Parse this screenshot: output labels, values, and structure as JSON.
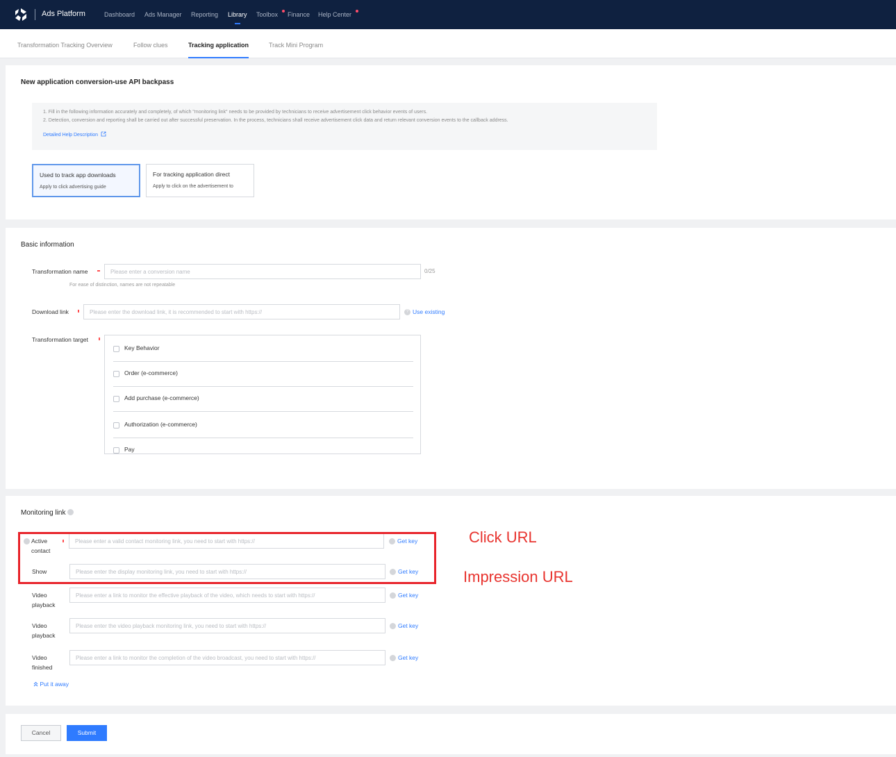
{
  "nav": {
    "brand": "Ads Platform",
    "items": [
      "Dashboard",
      "Ads Manager",
      "Reporting",
      "Library",
      "Toolbox",
      "Finance",
      "Help Center"
    ],
    "active": "Library"
  },
  "subtabs": [
    "Transformation Tracking Overview",
    "Follow clues",
    "Tracking application",
    "Track Mini Program"
  ],
  "intro": {
    "title": "New application conversion-use API backpass",
    "notice": [
      "1. Fill in the following information accurately and completely, of which \"monitoring link\" needs to be provided by technicians to receive advertisement click behavior events of users.",
      "2. Detection, conversion and reporting shall be carried out after successful preservation. In the process, technicians shall receive advertisement click data and return relevant conversion events to the callback address."
    ],
    "help_link": "Detailed Help Description",
    "options": [
      {
        "title": "Used to track app downloads",
        "subtitle": "Apply to click advertising guide",
        "selected": true
      },
      {
        "title": "For tracking application direct",
        "subtitle": "Apply to click on the advertisement to",
        "selected": false
      }
    ]
  },
  "basic": {
    "title": "Basic information",
    "name_label": "Transformation name",
    "name_placeholder": "Please enter a conversion name",
    "name_counter": "0/25",
    "name_hint": "For ease of distinction, names are not repeatable",
    "download_label": "Download link",
    "download_placeholder": "Please enter the download link, it is recommended to start with https://",
    "use_existing": "Use existing",
    "target_label": "Transformation target",
    "targets": [
      "Key Behavior",
      "Order (e-commerce)",
      "Add purchase (e-commerce)",
      "Authorization (e-commerce)",
      "Pay"
    ]
  },
  "monitoring": {
    "title": "Monitoring link",
    "get_key": "Get key",
    "rows": [
      {
        "label": "Active contact",
        "placeholder": "Please enter a valid contact monitoring link, you need to start with https://",
        "required": true
      },
      {
        "label": "Show",
        "placeholder": "Please enter the display monitoring link, you need to start with https://",
        "required": false
      },
      {
        "label": "Video playback",
        "placeholder": "Please enter a link to monitor the effective playback of the video, which needs to start with https://",
        "required": false
      },
      {
        "label": "Video playback",
        "placeholder": "Please enter the video playback monitoring link, you need to start with https://",
        "required": false
      },
      {
        "label": "Video finished",
        "placeholder": "Please enter a link to monitor the completion of the video broadcast, you need to start with https://",
        "required": false
      }
    ],
    "collapse": "Put it away"
  },
  "annotations": {
    "click": "Click URL",
    "impression": "Impression URL",
    "color": "#e8232a"
  },
  "footer": {
    "cancel": "Cancel",
    "submit": "Submit"
  },
  "colors": {
    "nav_bg": "#0f2140",
    "accent": "#2f7bff"
  }
}
